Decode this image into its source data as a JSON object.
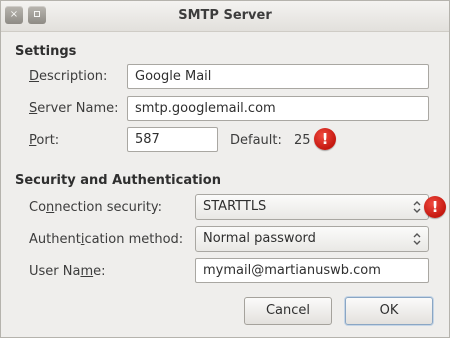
{
  "window": {
    "title": "SMTP Server"
  },
  "titlebar": {
    "close_glyph": "×",
    "icons": [
      "close-icon",
      "maximize-icon"
    ]
  },
  "settings": {
    "heading": "Settings",
    "description": {
      "label_mnemonic": "D",
      "label_rest": "escription:",
      "value": "Google Mail"
    },
    "server_name": {
      "label_mnemonic": "S",
      "label_rest": "erver Name:",
      "value": "smtp.googlemail.com"
    },
    "port": {
      "label_mnemonic": "P",
      "label_rest": "ort:",
      "value": "587",
      "default_label": "Default:",
      "default_value": "25"
    }
  },
  "security": {
    "heading": "Security and Authentication",
    "connection": {
      "label_pre": "Co",
      "label_mnemonic": "n",
      "label_rest": "nection security:",
      "value": "STARTTLS"
    },
    "auth_method": {
      "label_pre": "Authent",
      "label_mnemonic": "i",
      "label_rest": "cation method:",
      "value": "Normal password"
    },
    "user_name": {
      "label_pre": "User Na",
      "label_mnemonic": "m",
      "label_rest": "e:",
      "value": "mymail@martianuswb.com"
    }
  },
  "warning_glyph": "!",
  "buttons": {
    "cancel": "Cancel",
    "ok": "OK"
  },
  "colors": {
    "warning": "#d42a1f",
    "accent": "#8aa6c4"
  }
}
